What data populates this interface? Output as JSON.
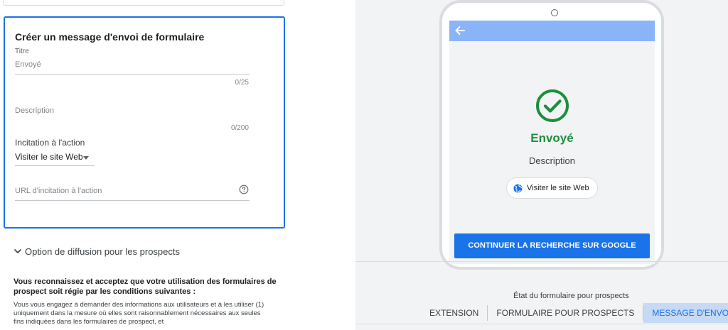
{
  "form": {
    "title": "Créer un message d'envoi de formulaire",
    "titre_label": "Titre",
    "titre_value": "Envoyé",
    "titre_counter": "0/25",
    "description_label": "Description",
    "description_counter": "0/200",
    "cta_label": "Incitation à l'action",
    "cta_value": "Visiter le site Web",
    "cta_url_placeholder": "URL d'incitation à l'action"
  },
  "delivery_option": {
    "label": "Option de diffusion pour les prospects"
  },
  "terms": {
    "heading": "Vous reconnaissez et acceptez que votre utilisation des formulaires de prospect soit régie par les conditions suivantes :",
    "body": "Vous vous engagez à demander des informations aux utilisateurs et à les utiliser (1) uniquement dans la mesure où elles sont raisonnablement nécessaires aux seules fins indiquées dans les formulaires de prospect, et"
  },
  "preview": {
    "sent_title": "Envoyé",
    "sent_description": "Description",
    "visit_button": "Visiter le site Web",
    "continue_button": "CONTINUER LA RECHERCHE SUR GOOGLE",
    "status_caption": "État du formulaire pour prospects",
    "tabs": [
      {
        "label": "EXTENSION",
        "active": false
      },
      {
        "label": "FORMULAIRE POUR PROSPECTS",
        "active": false
      },
      {
        "label": "MESSAGE D'ENVOI",
        "active": true
      }
    ]
  },
  "icons": {
    "back": "arrow-back-icon",
    "check": "check-circle-icon",
    "globe": "globe-icon",
    "help": "help-circle-icon",
    "expand": "chevron-down-icon"
  },
  "colors": {
    "accent": "#1a73e8",
    "success": "#1e8e3e",
    "app_bar": "#8ab4f8",
    "active_tab_bg": "#c6d9f5"
  }
}
